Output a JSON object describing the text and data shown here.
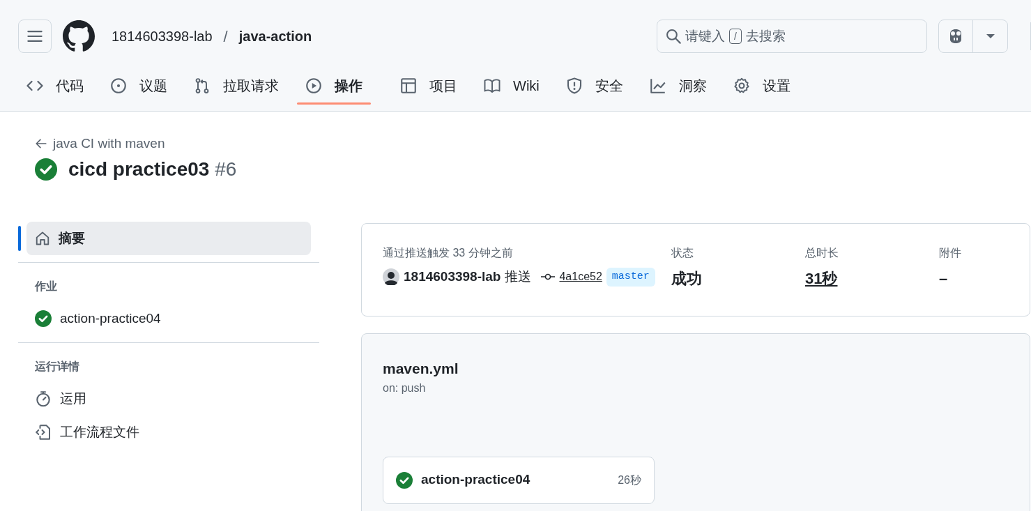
{
  "header": {
    "owner": "1814603398-lab",
    "separator": "/",
    "repo": "java-action",
    "search": {
      "before": "请键入",
      "key": "/",
      "after": "去搜索"
    }
  },
  "tabs": [
    {
      "label": "代码",
      "kind": "code",
      "selected": false
    },
    {
      "label": "议题",
      "kind": "issue",
      "selected": false
    },
    {
      "label": "拉取请求",
      "kind": "pull",
      "selected": false
    },
    {
      "label": "操作",
      "kind": "play",
      "selected": true
    },
    {
      "label": "项目",
      "kind": "table",
      "selected": false
    },
    {
      "label": "Wiki",
      "kind": "book",
      "selected": false
    },
    {
      "label": "安全",
      "kind": "shield",
      "selected": false
    },
    {
      "label": "洞察",
      "kind": "graph",
      "selected": false
    },
    {
      "label": "设置",
      "kind": "gear",
      "selected": false
    }
  ],
  "back_link": "java CI with maven",
  "run": {
    "title": "cicd practice03",
    "number": "#6",
    "kind": "success"
  },
  "sidebar": {
    "summary": {
      "label": "摘要",
      "selected": true
    },
    "sections": [
      {
        "heading": "作业",
        "items": [
          {
            "label": "action-practice04",
            "kind": "success"
          }
        ]
      },
      {
        "heading": "运行详情",
        "items": [
          {
            "label": "运用",
            "kind": "stopwatch"
          },
          {
            "label": "工作流程文件",
            "kind": "file-code"
          }
        ]
      }
    ]
  },
  "summary": {
    "trigger": "通过推送触发 33 分钟之前",
    "actor": "1814603398-lab",
    "action": "推送",
    "commit": "4a1ce52",
    "branch": "master",
    "fields": [
      {
        "label": "状态",
        "value": "成功",
        "link": false
      },
      {
        "label": "总时长",
        "value": "31秒",
        "link": true
      },
      {
        "label": "附件",
        "value": "–",
        "link": false
      }
    ]
  },
  "workflow": {
    "file": "maven.yml",
    "trigger": "on: push",
    "jobs": [
      {
        "name": "action-practice04",
        "duration": "26秒",
        "kind": "success"
      }
    ]
  }
}
